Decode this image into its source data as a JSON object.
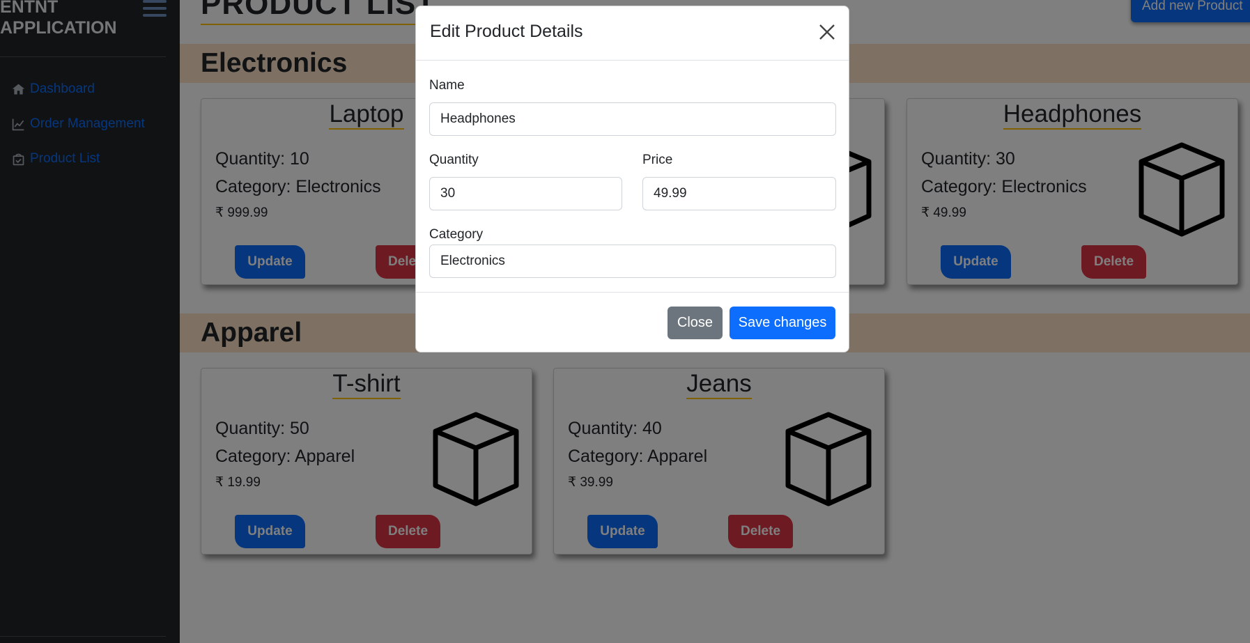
{
  "sidebar": {
    "brand_line1": "ENTNT",
    "brand_line2": "APPLICATION",
    "items": [
      {
        "label": "Dashboard",
        "icon": "home-icon"
      },
      {
        "label": "Order Management",
        "icon": "chart-line-icon"
      },
      {
        "label": "Product List",
        "icon": "shopping-bag-icon"
      }
    ]
  },
  "main": {
    "title": "PRODUCT LIST",
    "add_button": "Add new Product",
    "categories": [
      {
        "name": "Electronics",
        "products": [
          {
            "name": "Laptop",
            "quantity": "Quantity: 10",
            "category": "Category: Electronics",
            "price": "₹ 999.99"
          },
          {
            "name": "Headphones",
            "quantity": "Quantity: 30",
            "category": "Category: Electronics",
            "price": "₹ 49.99"
          }
        ]
      },
      {
        "name": "Apparel",
        "products": [
          {
            "name": "T-shirt",
            "quantity": "Quantity: 50",
            "category": "Category: Apparel",
            "price": "₹ 19.99"
          },
          {
            "name": "Jeans",
            "quantity": "Quantity: 40",
            "category": "Category: Apparel",
            "price": "₹ 39.99"
          }
        ]
      }
    ],
    "update_label": "Update",
    "delete_label": "Delete"
  },
  "modal": {
    "title": "Edit Product Details",
    "name_label": "Name",
    "name_value": "Headphones",
    "quantity_label": "Quantity",
    "quantity_value": "30",
    "price_label": "Price",
    "price_value": "49.99",
    "category_label": "Category",
    "category_value": "Electronics",
    "close_label": "Close",
    "save_label": "Save changes"
  },
  "colors": {
    "primary": "#0d6efd",
    "danger": "#dc3545",
    "secondary": "#6c757d",
    "sidebar_bg": "#212529",
    "accent_underline": "#ffc107",
    "category_band": "#fde0c6"
  }
}
